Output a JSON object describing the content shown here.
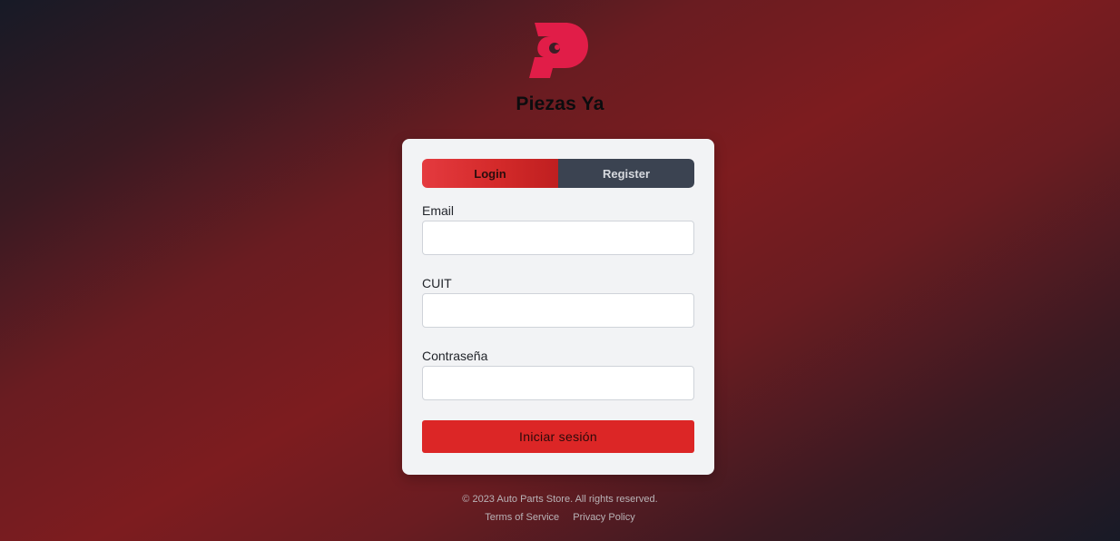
{
  "app": {
    "logo_icon": "piezas-ya-p-logo-icon",
    "brand_name": "Piezas Ya",
    "accent_color": "#dc2626"
  },
  "auth": {
    "tabs": [
      {
        "label": "Login",
        "active": true
      },
      {
        "label": "Register",
        "active": false
      }
    ],
    "fields": {
      "email": {
        "label": "Email",
        "value": "",
        "placeholder": ""
      },
      "cuit": {
        "label": "CUIT",
        "value": "",
        "placeholder": ""
      },
      "password": {
        "label": "Contraseña",
        "value": "",
        "placeholder": ""
      }
    },
    "submit_label": "Iniciar sesión"
  },
  "footer": {
    "copyright": "© 2023 Auto Parts Store. All rights reserved.",
    "links": [
      "Terms of Service",
      "Privacy Policy"
    ]
  }
}
